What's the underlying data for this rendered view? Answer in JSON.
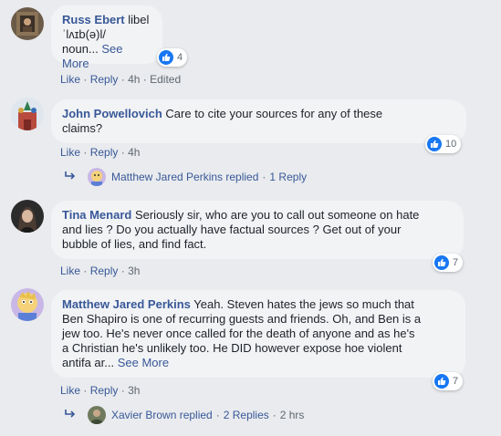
{
  "comments": [
    {
      "author": "Russ Ebert",
      "text_line1": " libel",
      "text_line2": "ˈlʌɪb(ə)l/",
      "text_line3": "noun...",
      "see_more": "See More",
      "reactions": "4",
      "like": "Like",
      "reply": "Reply",
      "time": "4h",
      "edited": "Edited"
    },
    {
      "author": "John Powellovich",
      "text_line1": " Care to cite your sources for any of these",
      "text_line2": "claims?",
      "reactions": "10",
      "like": "Like",
      "reply": "Reply",
      "time": "4h",
      "replies_name": "Matthew Jared Perkins replied",
      "replies_count": "1 Reply"
    },
    {
      "author": "Tina Menard",
      "text_line1": " Seriously sir, who are you to call out someone on hate",
      "text_line2": "and lies ? Do you actually have factual sources ? Get out of your",
      "text_line3": "bubble of lies, and find fact.",
      "reactions": "7",
      "like": "Like",
      "reply": "Reply",
      "time": "3h"
    },
    {
      "author": "Matthew Jared Perkins",
      "text_line1": " Yeah. Steven hates the jews so much that",
      "text_line2": "Ben Shapiro is one of recurring guests and friends. Oh, and Ben is a",
      "text_line3": "jew too. He's never once called for the death of anyone and as he's",
      "text_line4": "a Christian he's unlikely too. He DID however expose hoe violent",
      "text_line5": "antifa ar...",
      "see_more": "See More",
      "reactions": "7",
      "like": "Like",
      "reply": "Reply",
      "time": "3h",
      "replies_name": "Xavier Brown replied",
      "replies_count": "2 Replies",
      "replies_time": "2 hrs"
    }
  ],
  "separator": "·",
  "colors": {
    "link": "#385898",
    "meta": "#606770",
    "bubble": "#f2f3f5",
    "like_blue": "#1877f2"
  },
  "icons": [
    "thumbs-up-icon",
    "reply-arrow-icon"
  ]
}
